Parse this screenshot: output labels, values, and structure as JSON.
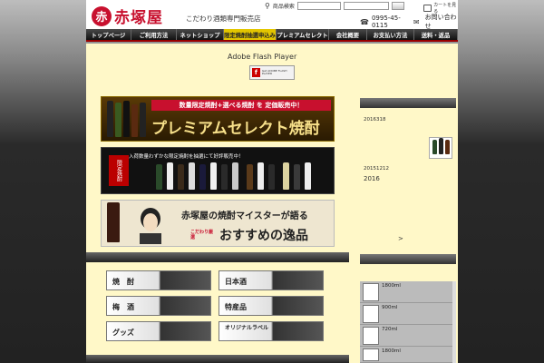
{
  "header": {
    "logo_mark": "赤",
    "logo_text": "赤塚屋",
    "tagline": "こだわり酒類専門販売店",
    "search_label": "商品検索",
    "cart_label": "カートを見る",
    "phone": "0995-45-0115",
    "contact": "お問い合わせ"
  },
  "nav": [
    {
      "label": "トップページ",
      "highlight": false
    },
    {
      "label": "ご利用方法",
      "highlight": false
    },
    {
      "label": "ネットショップ",
      "highlight": false
    },
    {
      "label": "限定焼酎抽選申込み",
      "highlight": true
    },
    {
      "label": "プレミアムセレクト",
      "highlight": false
    },
    {
      "label": "会社概要",
      "highlight": false
    },
    {
      "label": "お支払い方法",
      "highlight": false
    },
    {
      "label": "送料・返品",
      "highlight": false
    }
  ],
  "flash": {
    "title": "Adobe Flash Player",
    "badge_small": "Get ADOBE FLASH PLAYER",
    "badge_icon": "f"
  },
  "banners": {
    "b1_top": "数量限定焼酎+選べる焼酎 を 定価販売中！",
    "b1_main": "プレミアムセレクト焼酎",
    "b2_text": "入荷数量わずかな限定焼酎を抽選にて好評販売中！",
    "b2_tag": "限定焼酎",
    "b3_text1": "赤塚屋の焼酎マイスターが語る",
    "b3_text2": "おすすめの逸品",
    "b3_tag": "こだわり厳選"
  },
  "categories": [
    {
      "label": "焼　酎"
    },
    {
      "label": "日本酒"
    },
    {
      "label": "梅　酒"
    },
    {
      "label": "特産品"
    },
    {
      "label": "グッズ"
    },
    {
      "label": "オリジナルラベル"
    }
  ],
  "news": [
    {
      "date": "2016318"
    },
    {
      "date": "20151212",
      "title": "2016"
    }
  ],
  "news_more": ">",
  "ranking": [
    {
      "label": "1800ml"
    },
    {
      "label": "900ml"
    },
    {
      "label": "720ml"
    },
    {
      "label": "1800ml"
    }
  ],
  "colors": {
    "brand_red": "#c8102e",
    "content_bg": "#fff8c8",
    "nav_highlight": "#e3c600"
  }
}
